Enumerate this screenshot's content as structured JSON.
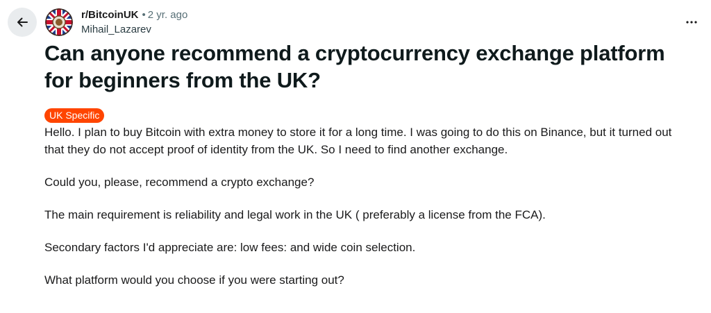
{
  "header": {
    "subreddit": "r/BitcoinUK",
    "separator": "•",
    "age": "2 yr. ago",
    "author": "Mihail_Lazarev"
  },
  "post": {
    "title": "Can anyone recommend a cryptocurrency exchange platform for beginners from the UK?",
    "flair": "UK Specific",
    "paragraphs": [
      "Hello. I plan to buy Bitcoin with extra money to store it for a long time. I was going to do this on Binance, but it turned out that they do not accept proof of identity from the UK. So I need to find another exchange.",
      "Could you, please, recommend a crypto exchange?",
      "The main requirement is reliability and legal work in the UK ( preferably a license from the FCA).",
      "Secondary factors I'd appreciate are: low fees: and wide coin selection.",
      "What platform would you choose if you were starting out?"
    ]
  },
  "icons": {
    "back": "arrow-left-icon",
    "more": "more-horizontal-icon",
    "avatar": "subreddit-avatar-union-jack-bitcoin"
  },
  "colors": {
    "flair_background": "#ff4500",
    "back_button_background": "#e9ecee",
    "meta_text": "#576f76"
  }
}
